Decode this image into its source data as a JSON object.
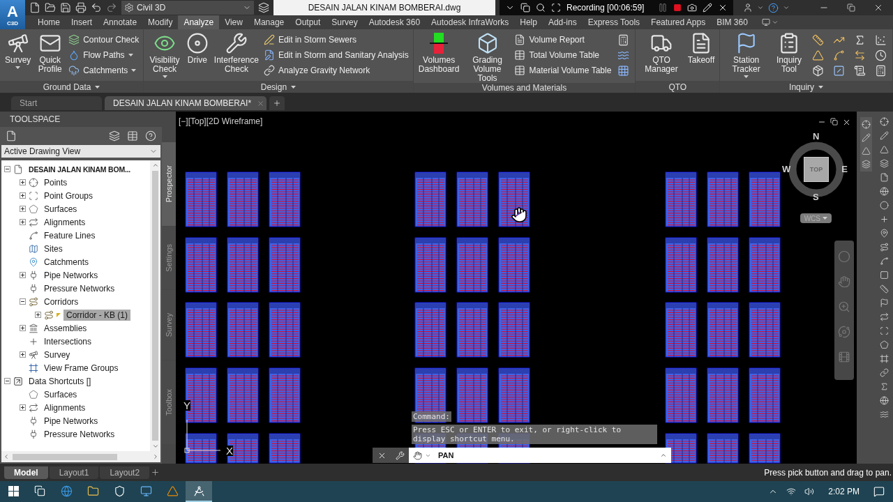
{
  "title_bar": {
    "logo_letter": "A",
    "logo_product": "C3D",
    "workspace": "Civil 3D",
    "document": "DESAIN JALAN KINAM BOMBERAI.dwg",
    "recording": "Recording [00:06:59]"
  },
  "menu_tabs": [
    {
      "label": "Home",
      "selected": false
    },
    {
      "label": "Insert",
      "selected": false
    },
    {
      "label": "Annotate",
      "selected": false
    },
    {
      "label": "Modify",
      "selected": false
    },
    {
      "label": "Analyze",
      "selected": true
    },
    {
      "label": "View",
      "selected": false
    },
    {
      "label": "Manage",
      "selected": false
    },
    {
      "label": "Output",
      "selected": false
    },
    {
      "label": "Survey",
      "selected": false
    },
    {
      "label": "Autodesk 360",
      "selected": false
    },
    {
      "label": "Autodesk InfraWorks",
      "selected": false
    },
    {
      "label": "Help",
      "selected": false
    },
    {
      "label": "Add-ins",
      "selected": false
    },
    {
      "label": "Express Tools",
      "selected": false
    },
    {
      "label": "Featured Apps",
      "selected": false
    },
    {
      "label": "BIM 360",
      "selected": false
    }
  ],
  "ribbon": {
    "panels": [
      {
        "title": "Ground Data",
        "menu": true,
        "tools": [
          {
            "kind": "large",
            "label": "Survey",
            "dropdown": true
          },
          {
            "kind": "large",
            "label": "Quick Profile",
            "dropdown": false
          },
          {
            "kind": "small",
            "label": "Contour Check",
            "dropdown": false
          },
          {
            "kind": "small",
            "label": "Flow Paths",
            "dropdown": true
          },
          {
            "kind": "small",
            "label": "Catchments",
            "dropdown": true
          }
        ]
      },
      {
        "title": "Design",
        "menu": true,
        "tools": [
          {
            "kind": "large",
            "label": "Visibility Check",
            "dropdown": true
          },
          {
            "kind": "large",
            "label": "Drive",
            "dropdown": false
          },
          {
            "kind": "large",
            "label": "Interference Check",
            "dropdown": false
          },
          {
            "kind": "small",
            "label": "Edit in Storm Sewers",
            "dropdown": false
          },
          {
            "kind": "small",
            "label": "Edit in Storm and Sanitary Analysis",
            "dropdown": false
          },
          {
            "kind": "small",
            "label": "Analyze Gravity Network",
            "dropdown": false
          }
        ]
      },
      {
        "title": "Volumes and Materials",
        "menu": false,
        "tools": [
          {
            "kind": "large",
            "label": "Volumes Dashboard",
            "dropdown": false
          },
          {
            "kind": "large",
            "label": "Grading Volume Tools",
            "dropdown": false
          },
          {
            "kind": "small",
            "label": "Volume Report",
            "dropdown": false
          },
          {
            "kind": "small",
            "label": "Total Volume Table",
            "dropdown": false
          },
          {
            "kind": "small",
            "label": "Material Volume Table",
            "dropdown": false
          },
          {
            "kind": "icon"
          },
          {
            "kind": "icon"
          },
          {
            "kind": "icon"
          }
        ]
      },
      {
        "title": "QTO",
        "menu": false,
        "tools": [
          {
            "kind": "large",
            "label": "QTO Manager",
            "dropdown": false
          },
          {
            "kind": "large",
            "label": "Takeoff",
            "dropdown": false
          }
        ]
      },
      {
        "title": "Inquiry",
        "menu": true,
        "tools": [
          {
            "kind": "large",
            "label": "Station Tracker",
            "dropdown": true
          },
          {
            "kind": "large",
            "label": "Inquiry Tool",
            "dropdown": false
          },
          {
            "kind": "icon"
          },
          {
            "kind": "icon"
          },
          {
            "kind": "icon"
          },
          {
            "kind": "icon"
          },
          {
            "kind": "icon"
          },
          {
            "kind": "icon"
          },
          {
            "kind": "icon"
          },
          {
            "kind": "icon"
          },
          {
            "kind": "icon"
          },
          {
            "kind": "icon"
          },
          {
            "kind": "icon"
          },
          {
            "kind": "icon"
          }
        ]
      }
    ]
  },
  "document_tabs": [
    {
      "label": "Start",
      "selected": false
    },
    {
      "label": "DESAIN JALAN KINAM BOMBERAI*",
      "selected": true
    }
  ],
  "toolspace": {
    "title": "TOOLSPACE",
    "view_selector": "Active Drawing View",
    "tree": [
      {
        "label": "DESAIN JALAN KINAM BOM...",
        "current": true,
        "expanded": true,
        "selected": false,
        "children": [
          {
            "label": "Points",
            "expanded": false,
            "selected": false
          },
          {
            "label": "Point Groups",
            "expanded": false,
            "selected": false
          },
          {
            "label": "Surfaces",
            "expanded": false,
            "selected": false
          },
          {
            "label": "Alignments",
            "expanded": false,
            "selected": false
          },
          {
            "label": "Feature Lines",
            "selected": false
          },
          {
            "label": "Sites",
            "selected": false
          },
          {
            "label": "Catchments",
            "selected": false
          },
          {
            "label": "Pipe Networks",
            "expanded": false,
            "selected": false
          },
          {
            "label": "Pressure Networks",
            "selected": false
          },
          {
            "label": "Corridors",
            "expanded": true,
            "selected": false,
            "children": [
              {
                "label": "Corridor - KB (1)",
                "expanded": false,
                "selected": true,
                "out_of_date": true
              }
            ]
          },
          {
            "label": "Assemblies",
            "expanded": false,
            "selected": false
          },
          {
            "label": "Intersections",
            "selected": false
          },
          {
            "label": "Survey",
            "expanded": false,
            "selected": false
          },
          {
            "label": "View Frame Groups",
            "selected": false
          }
        ]
      },
      {
        "label": "Data Shortcuts []",
        "current": false,
        "expanded": true,
        "selected": false,
        "children": [
          {
            "label": "Surfaces",
            "selected": false
          },
          {
            "label": "Alignments",
            "expanded": false,
            "selected": false
          },
          {
            "label": "Pipe Networks",
            "selected": false
          },
          {
            "label": "Pressure Networks",
            "selected": false
          }
        ]
      }
    ],
    "side_tabs": [
      {
        "label": "Prospector",
        "selected": true
      },
      {
        "label": "Settings",
        "selected": false
      },
      {
        "label": "Survey",
        "selected": false
      },
      {
        "label": "Toolbox",
        "selected": false
      }
    ]
  },
  "viewport": {
    "label": "[−][Top][2D Wireframe]",
    "viewcube": {
      "north": "N",
      "east": "E",
      "south": "S",
      "west": "W",
      "face": "TOP",
      "coordinate_system": "WCS"
    },
    "ucs": {
      "x_axis": "X",
      "y_axis": "Y"
    },
    "command_history": [
      "Command:",
      "Press ESC or ENTER to exit, or right-click to display shortcut menu."
    ],
    "command_prompt": "PAN"
  },
  "layout_tabs": [
    {
      "label": "Model",
      "selected": true
    },
    {
      "label": "Layout1",
      "selected": false
    },
    {
      "label": "Layout2",
      "selected": false
    }
  ],
  "status_message": "Press pick button and drag to pan.",
  "taskbar": {
    "apps": [
      {
        "active": false
      },
      {
        "active": false
      },
      {
        "active": false
      },
      {
        "active": false
      },
      {
        "active": false
      },
      {
        "active": true
      }
    ],
    "clock": "2:02 PM"
  }
}
